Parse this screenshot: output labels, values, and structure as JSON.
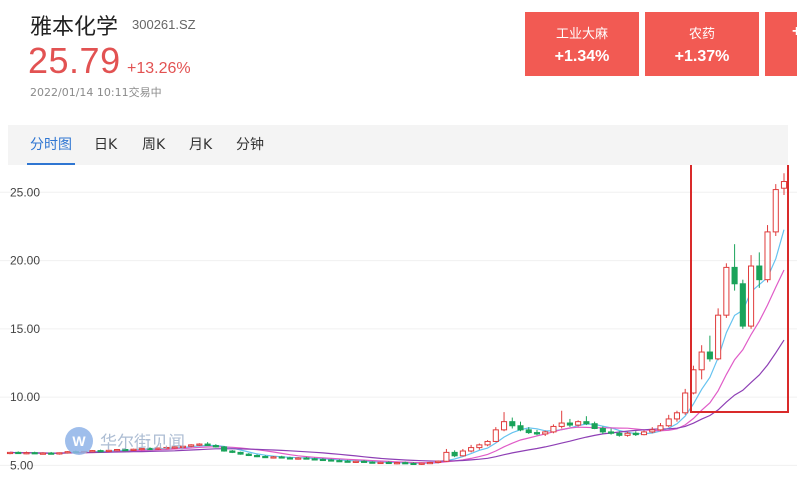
{
  "stock": {
    "name": "雅本化学",
    "code": "300261.SZ",
    "price": "25.79",
    "change_pct": "+13.26%",
    "timestamp": "2022/01/14 10:11交易中",
    "up_color": "#e25252"
  },
  "sectors": [
    {
      "name": "工业大麻",
      "change": "+1.34%"
    },
    {
      "name": "农药",
      "change": "+1.37%"
    },
    {
      "name": "",
      "change": "+"
    }
  ],
  "tabs": [
    {
      "label": "分时图",
      "active": true
    },
    {
      "label": "日K",
      "active": false
    },
    {
      "label": "周K",
      "active": false
    },
    {
      "label": "月K",
      "active": false
    },
    {
      "label": "分钟",
      "active": false
    }
  ],
  "watermark": "华尔街见闻",
  "chart_data": {
    "type": "candlestick",
    "y_ticks": [
      "25.00",
      "20.00",
      "15.00",
      "10.00",
      "5.00"
    ],
    "ylim": [
      4.0,
      27.0
    ],
    "colors": {
      "up": "#e03c3c",
      "down": "#1aa35a",
      "ma5": "#66c3f0",
      "ma10": "#e05cc8",
      "ma20": "#8e3fb5",
      "highlight": "#d92a2a"
    },
    "candles": [
      {
        "o": 5.91,
        "h": 5.98,
        "l": 5.81,
        "c": 5.95
      },
      {
        "o": 5.95,
        "h": 6.02,
        "l": 5.88,
        "c": 5.89
      },
      {
        "o": 5.89,
        "h": 6.01,
        "l": 5.82,
        "c": 5.93
      },
      {
        "o": 5.93,
        "h": 6.0,
        "l": 5.84,
        "c": 5.86
      },
      {
        "o": 5.86,
        "h": 5.96,
        "l": 5.8,
        "c": 5.9
      },
      {
        "o": 5.9,
        "h": 5.98,
        "l": 5.82,
        "c": 5.84
      },
      {
        "o": 5.84,
        "h": 5.95,
        "l": 5.78,
        "c": 5.92
      },
      {
        "o": 5.92,
        "h": 6.04,
        "l": 5.86,
        "c": 6.0
      },
      {
        "o": 6.0,
        "h": 6.08,
        "l": 5.92,
        "c": 5.95
      },
      {
        "o": 5.95,
        "h": 6.05,
        "l": 5.88,
        "c": 6.02
      },
      {
        "o": 6.02,
        "h": 6.12,
        "l": 5.96,
        "c": 6.08
      },
      {
        "o": 6.08,
        "h": 6.15,
        "l": 5.99,
        "c": 6.04
      },
      {
        "o": 6.04,
        "h": 6.14,
        "l": 5.97,
        "c": 6.1
      },
      {
        "o": 6.1,
        "h": 6.2,
        "l": 6.03,
        "c": 6.16
      },
      {
        "o": 6.16,
        "h": 6.25,
        "l": 6.08,
        "c": 6.12
      },
      {
        "o": 6.12,
        "h": 6.22,
        "l": 6.05,
        "c": 6.18
      },
      {
        "o": 6.18,
        "h": 6.28,
        "l": 6.1,
        "c": 6.24
      },
      {
        "o": 6.24,
        "h": 6.32,
        "l": 6.14,
        "c": 6.2
      },
      {
        "o": 6.2,
        "h": 6.3,
        "l": 6.12,
        "c": 6.27
      },
      {
        "o": 6.27,
        "h": 6.36,
        "l": 6.2,
        "c": 6.31
      },
      {
        "o": 6.31,
        "h": 6.4,
        "l": 6.22,
        "c": 6.35
      },
      {
        "o": 6.35,
        "h": 6.45,
        "l": 6.26,
        "c": 6.4
      },
      {
        "o": 6.4,
        "h": 6.55,
        "l": 6.33,
        "c": 6.5
      },
      {
        "o": 6.5,
        "h": 6.62,
        "l": 6.42,
        "c": 6.56
      },
      {
        "o": 6.56,
        "h": 6.7,
        "l": 6.48,
        "c": 6.45
      },
      {
        "o": 6.45,
        "h": 6.55,
        "l": 6.3,
        "c": 6.35
      },
      {
        "o": 6.35,
        "h": 6.42,
        "l": 6.0,
        "c": 6.05
      },
      {
        "o": 6.05,
        "h": 6.12,
        "l": 5.9,
        "c": 5.95
      },
      {
        "o": 5.95,
        "h": 6.0,
        "l": 5.78,
        "c": 5.82
      },
      {
        "o": 5.82,
        "h": 5.9,
        "l": 5.68,
        "c": 5.72
      },
      {
        "o": 5.72,
        "h": 5.8,
        "l": 5.6,
        "c": 5.65
      },
      {
        "o": 5.65,
        "h": 5.73,
        "l": 5.55,
        "c": 5.58
      },
      {
        "o": 5.58,
        "h": 5.68,
        "l": 5.5,
        "c": 5.62
      },
      {
        "o": 5.62,
        "h": 5.7,
        "l": 5.52,
        "c": 5.55
      },
      {
        "o": 5.55,
        "h": 5.63,
        "l": 5.46,
        "c": 5.5
      },
      {
        "o": 5.5,
        "h": 5.6,
        "l": 5.42,
        "c": 5.54
      },
      {
        "o": 5.54,
        "h": 5.62,
        "l": 5.45,
        "c": 5.48
      },
      {
        "o": 5.48,
        "h": 5.56,
        "l": 5.4,
        "c": 5.44
      },
      {
        "o": 5.44,
        "h": 5.52,
        "l": 5.35,
        "c": 5.4
      },
      {
        "o": 5.4,
        "h": 5.48,
        "l": 5.3,
        "c": 5.35
      },
      {
        "o": 5.35,
        "h": 5.44,
        "l": 5.27,
        "c": 5.31
      },
      {
        "o": 5.31,
        "h": 5.4,
        "l": 5.22,
        "c": 5.26
      },
      {
        "o": 5.26,
        "h": 5.35,
        "l": 5.18,
        "c": 5.3
      },
      {
        "o": 5.3,
        "h": 5.38,
        "l": 5.2,
        "c": 5.24
      },
      {
        "o": 5.24,
        "h": 5.3,
        "l": 5.14,
        "c": 5.18
      },
      {
        "o": 5.18,
        "h": 5.26,
        "l": 5.1,
        "c": 5.22
      },
      {
        "o": 5.22,
        "h": 5.3,
        "l": 5.14,
        "c": 5.16
      },
      {
        "o": 5.16,
        "h": 5.25,
        "l": 5.08,
        "c": 5.2
      },
      {
        "o": 5.2,
        "h": 5.28,
        "l": 5.12,
        "c": 5.15
      },
      {
        "o": 5.15,
        "h": 5.22,
        "l": 5.06,
        "c": 5.1
      },
      {
        "o": 5.1,
        "h": 5.2,
        "l": 5.04,
        "c": 5.16
      },
      {
        "o": 5.16,
        "h": 5.25,
        "l": 5.1,
        "c": 5.21
      },
      {
        "o": 5.21,
        "h": 5.36,
        "l": 5.15,
        "c": 5.3
      },
      {
        "o": 5.3,
        "h": 6.2,
        "l": 5.25,
        "c": 5.95
      },
      {
        "o": 5.95,
        "h": 6.1,
        "l": 5.6,
        "c": 5.7
      },
      {
        "o": 5.7,
        "h": 6.2,
        "l": 5.65,
        "c": 6.05
      },
      {
        "o": 6.05,
        "h": 6.5,
        "l": 5.95,
        "c": 6.3
      },
      {
        "o": 6.3,
        "h": 6.6,
        "l": 6.15,
        "c": 6.5
      },
      {
        "o": 6.5,
        "h": 6.85,
        "l": 6.4,
        "c": 6.75
      },
      {
        "o": 6.75,
        "h": 7.8,
        "l": 6.7,
        "c": 7.6
      },
      {
        "o": 7.6,
        "h": 8.9,
        "l": 7.5,
        "c": 8.2
      },
      {
        "o": 8.2,
        "h": 8.5,
        "l": 7.7,
        "c": 7.9
      },
      {
        "o": 7.9,
        "h": 8.2,
        "l": 7.5,
        "c": 7.6
      },
      {
        "o": 7.6,
        "h": 7.8,
        "l": 7.3,
        "c": 7.4
      },
      {
        "o": 7.4,
        "h": 7.6,
        "l": 7.2,
        "c": 7.3
      },
      {
        "o": 7.3,
        "h": 7.55,
        "l": 7.15,
        "c": 7.45
      },
      {
        "o": 7.45,
        "h": 8.0,
        "l": 7.35,
        "c": 7.85
      },
      {
        "o": 7.85,
        "h": 9.0,
        "l": 7.7,
        "c": 8.1
      },
      {
        "o": 8.1,
        "h": 8.4,
        "l": 7.8,
        "c": 7.95
      },
      {
        "o": 7.95,
        "h": 8.3,
        "l": 7.85,
        "c": 8.2
      },
      {
        "o": 8.2,
        "h": 8.6,
        "l": 7.95,
        "c": 8.05
      },
      {
        "o": 8.05,
        "h": 8.2,
        "l": 7.65,
        "c": 7.7
      },
      {
        "o": 7.7,
        "h": 7.85,
        "l": 7.3,
        "c": 7.45
      },
      {
        "o": 7.45,
        "h": 7.7,
        "l": 7.25,
        "c": 7.35
      },
      {
        "o": 7.35,
        "h": 7.5,
        "l": 7.1,
        "c": 7.2
      },
      {
        "o": 7.2,
        "h": 7.45,
        "l": 7.1,
        "c": 7.35
      },
      {
        "o": 7.35,
        "h": 7.5,
        "l": 7.15,
        "c": 7.25
      },
      {
        "o": 7.25,
        "h": 7.55,
        "l": 7.2,
        "c": 7.45
      },
      {
        "o": 7.45,
        "h": 7.8,
        "l": 7.35,
        "c": 7.6
      },
      {
        "o": 7.6,
        "h": 8.1,
        "l": 7.5,
        "c": 7.9
      },
      {
        "o": 7.9,
        "h": 8.7,
        "l": 7.8,
        "c": 8.4
      },
      {
        "o": 8.4,
        "h": 9.0,
        "l": 8.2,
        "c": 8.85
      },
      {
        "o": 8.85,
        "h": 10.6,
        "l": 8.7,
        "c": 10.3
      },
      {
        "o": 10.3,
        "h": 12.3,
        "l": 10.2,
        "c": 12.0
      },
      {
        "o": 12.0,
        "h": 13.8,
        "l": 11.3,
        "c": 13.3
      },
      {
        "o": 13.3,
        "h": 14.5,
        "l": 12.6,
        "c": 12.8
      },
      {
        "o": 12.8,
        "h": 16.5,
        "l": 12.7,
        "c": 16.0
      },
      {
        "o": 16.0,
        "h": 19.8,
        "l": 15.8,
        "c": 19.5
      },
      {
        "o": 19.5,
        "h": 21.2,
        "l": 17.8,
        "c": 18.3
      },
      {
        "o": 18.3,
        "h": 18.6,
        "l": 15.0,
        "c": 15.2
      },
      {
        "o": 15.2,
        "h": 20.4,
        "l": 15.0,
        "c": 19.6
      },
      {
        "o": 19.6,
        "h": 20.6,
        "l": 18.0,
        "c": 18.6
      },
      {
        "o": 18.6,
        "h": 22.6,
        "l": 18.4,
        "c": 22.1
      },
      {
        "o": 22.1,
        "h": 25.6,
        "l": 21.8,
        "c": 25.2
      },
      {
        "o": 25.3,
        "h": 26.4,
        "l": 24.8,
        "c": 25.79
      }
    ]
  }
}
